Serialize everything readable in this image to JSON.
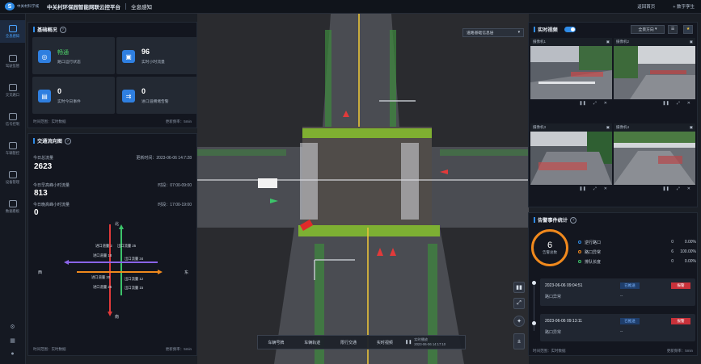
{
  "header": {
    "logo_text": "中关村科学城",
    "platform_title": "中关村环保园智能网联云控平台",
    "module_title": "全息感知",
    "links": [
      "返回首页",
      "+ 数字孪生"
    ]
  },
  "sidebar": {
    "items": [
      {
        "label": "全息感知",
        "icon": "monitor-icon",
        "active": true
      },
      {
        "label": "驾驶监管",
        "icon": "car-icon"
      },
      {
        "label": "交叉路口",
        "icon": "intersection-icon"
      },
      {
        "label": "信号控制",
        "icon": "signal-icon"
      },
      {
        "label": "车辆管控",
        "icon": "vehicle-icon"
      },
      {
        "label": "设备管理",
        "icon": "device-icon"
      },
      {
        "label": "数据看板",
        "icon": "dashboard-icon"
      }
    ],
    "bottom_icons": [
      "settings-icon",
      "grid-icon",
      "user-icon"
    ]
  },
  "overview": {
    "title": "基础概况",
    "cards": [
      {
        "value": "畅通",
        "label": "路口运行状态",
        "icon": "traffic-status-icon"
      },
      {
        "value": "96",
        "label": "实时小时流量",
        "icon": "car-flow-icon"
      },
      {
        "value": "0",
        "label": "实时今日事件",
        "icon": "event-icon"
      },
      {
        "value": "0",
        "label": "进口道拥堵告警",
        "icon": "congestion-icon"
      }
    ],
    "footer_left": "时间范围：实时数据",
    "footer_right": "更新频率：5min"
  },
  "flow": {
    "title": "交通流向图",
    "today_total_label": "今日总流量",
    "update_time": "更新时间：2023-06-06 14:7:28",
    "today_total": "2623",
    "morning_label": "今日早高峰小时流量",
    "morning_time": "时段：07:00-09:00",
    "morning_value": "813",
    "evening_label": "今日晚高峰小时流量",
    "evening_time": "时段：17:00-19:00",
    "evening_value": "0",
    "directions": {
      "north": "北",
      "south": "南",
      "east": "东",
      "west": "西"
    },
    "flows": [
      {
        "label": "进口道量 2",
        "color": "#e23a3a"
      },
      {
        "label": "出口流量 25",
        "color": "#e23a3a"
      },
      {
        "label": "进口道量 18",
        "color": "#8a64e8"
      },
      {
        "label": "出口流量 34",
        "color": "#f0891d"
      },
      {
        "label": "进口道量 30",
        "color": "#f0891d"
      },
      {
        "label": "出口流量 12",
        "color": "#8a64e8"
      },
      {
        "label": "进口道量 26",
        "color": "#3cc46a"
      },
      {
        "label": "出口流量 15",
        "color": "#3cc46a"
      }
    ],
    "footer_left": "时间范围：实时数据",
    "footer_right": "更新频率：5min"
  },
  "map": {
    "view_select": "道路基础信息层",
    "bottom_tabs": [
      "车辆号牌",
      "车辆轨迹",
      "限行交通",
      "实时视频"
    ],
    "play_label": "实时播放",
    "play_time": "2023-06-06 14:17:10"
  },
  "video": {
    "title": "实时视频",
    "split_select": "全景方向",
    "cameras": [
      {
        "name": "摄像机1"
      },
      {
        "name": "摄像机2"
      },
      {
        "name": "摄像机3"
      },
      {
        "name": "摄像机4"
      }
    ]
  },
  "alarms": {
    "title": "告警事件统计",
    "total": "6",
    "total_label": "告警总数",
    "legend": [
      {
        "label": "逆行路口",
        "count": "0",
        "pct": "0.00%"
      },
      {
        "label": "路口异常",
        "count": "6",
        "pct": "100.00%"
      },
      {
        "label": "排队长度",
        "count": "0",
        "pct": "0.00%"
      }
    ],
    "events": [
      {
        "time": "2023-06-06 09:04:51",
        "type": "路口异常",
        "tag": "已推送",
        "status": "报警",
        "dash": "--"
      },
      {
        "time": "2023-06-06 09:13:11",
        "type": "路口异常",
        "tag": "已推送",
        "status": "报警",
        "dash": "--"
      }
    ],
    "footer_left": "时间范围：实时数据",
    "footer_right": "更新频率：5min"
  }
}
